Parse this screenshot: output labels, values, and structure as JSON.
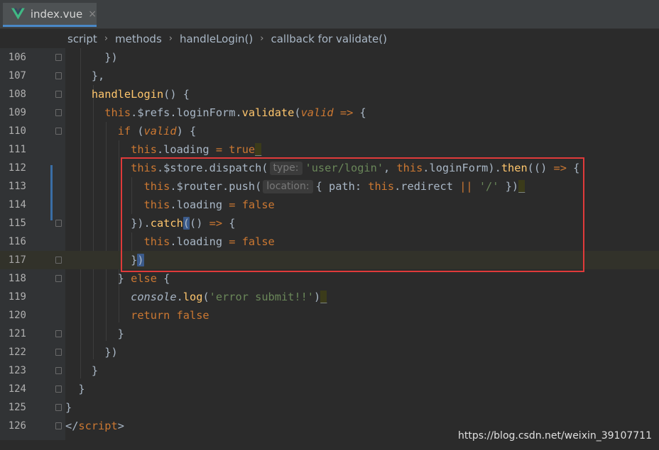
{
  "tab": {
    "file_name": "index.vue",
    "close_glyph": "×",
    "icon": "vue-logo-icon"
  },
  "breadcrumb": {
    "items": [
      "script",
      "methods",
      "handleLogin()",
      "callback for validate()"
    ],
    "separator": "›"
  },
  "lines": [
    {
      "n": "106"
    },
    {
      "n": "107"
    },
    {
      "n": "108"
    },
    {
      "n": "109"
    },
    {
      "n": "110"
    },
    {
      "n": "111"
    },
    {
      "n": "112"
    },
    {
      "n": "113"
    },
    {
      "n": "114"
    },
    {
      "n": "115"
    },
    {
      "n": "116"
    },
    {
      "n": "117"
    },
    {
      "n": "118"
    },
    {
      "n": "119"
    },
    {
      "n": "120"
    },
    {
      "n": "121"
    },
    {
      "n": "122"
    },
    {
      "n": "123"
    },
    {
      "n": "124"
    },
    {
      "n": "125"
    },
    {
      "n": "126"
    }
  ],
  "hints": {
    "type": "type:",
    "location": "location:"
  },
  "watermark": "https://blog.csdn.net/weixin_39107711",
  "colors": {
    "keyword": "#cc7832",
    "function": "#ffc66d",
    "string": "#6a8759",
    "default": "#a9b7c6",
    "highlight_box": "#e03a3a"
  }
}
